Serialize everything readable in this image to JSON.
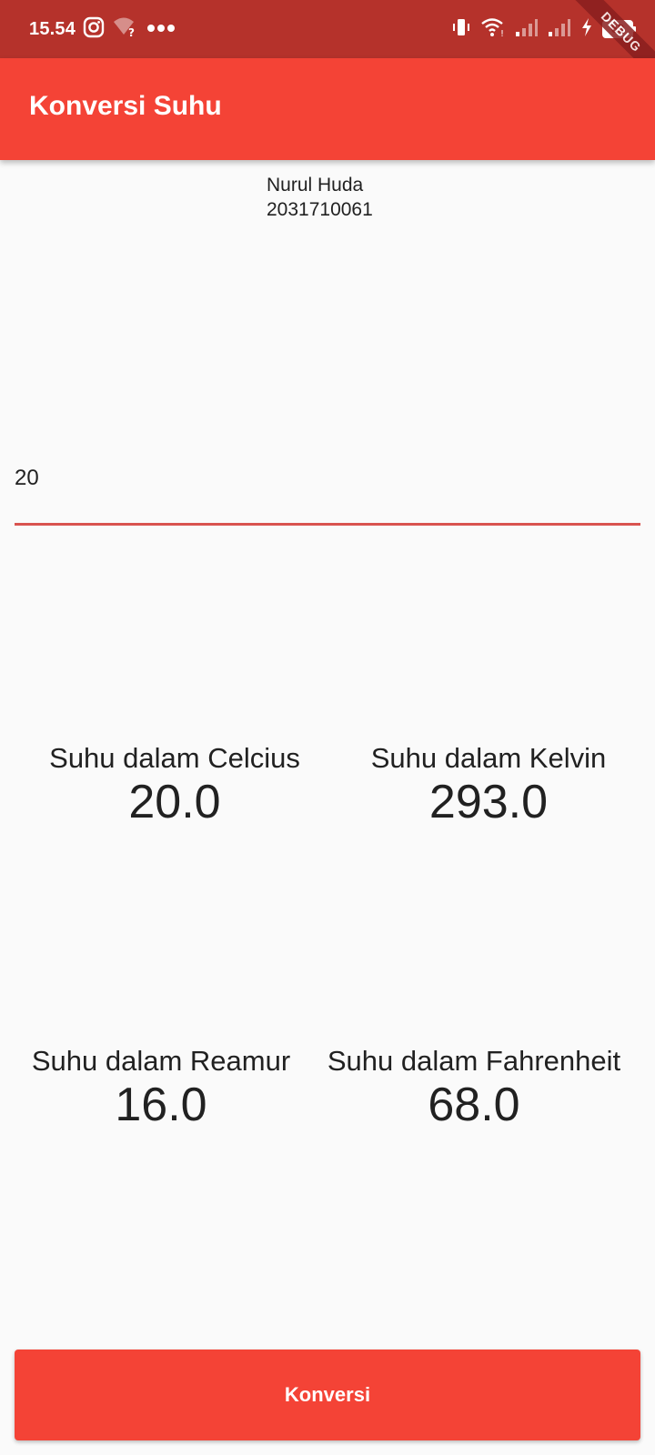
{
  "status_bar": {
    "time": "15.54",
    "battery_level": "69",
    "left_icons": [
      "instagram-icon",
      "wifi-question-icon",
      "more-dots-icon"
    ],
    "right_icons": [
      "vibrate-icon",
      "wifi-icon",
      "signal-icon",
      "signal-icon",
      "charging-icon",
      "battery-icon"
    ]
  },
  "debug_banner": "DEBUG",
  "app_bar": {
    "title": "Konversi Suhu",
    "color": "#f44336"
  },
  "student": {
    "name": "Nurul Huda",
    "nim": "2031710061"
  },
  "input": {
    "value": "20",
    "underline_color": "#d9534f"
  },
  "results": {
    "celcius": {
      "label": "Suhu dalam Celcius",
      "value": "20.0"
    },
    "kelvin": {
      "label": "Suhu dalam Kelvin",
      "value": "293.0"
    },
    "reamur": {
      "label": "Suhu dalam Reamur",
      "value": "16.0"
    },
    "fahrenheit": {
      "label": "Suhu dalam Fahrenheit",
      "value": "68.0"
    }
  },
  "button": {
    "label": "Konversi",
    "color": "#f44336"
  }
}
